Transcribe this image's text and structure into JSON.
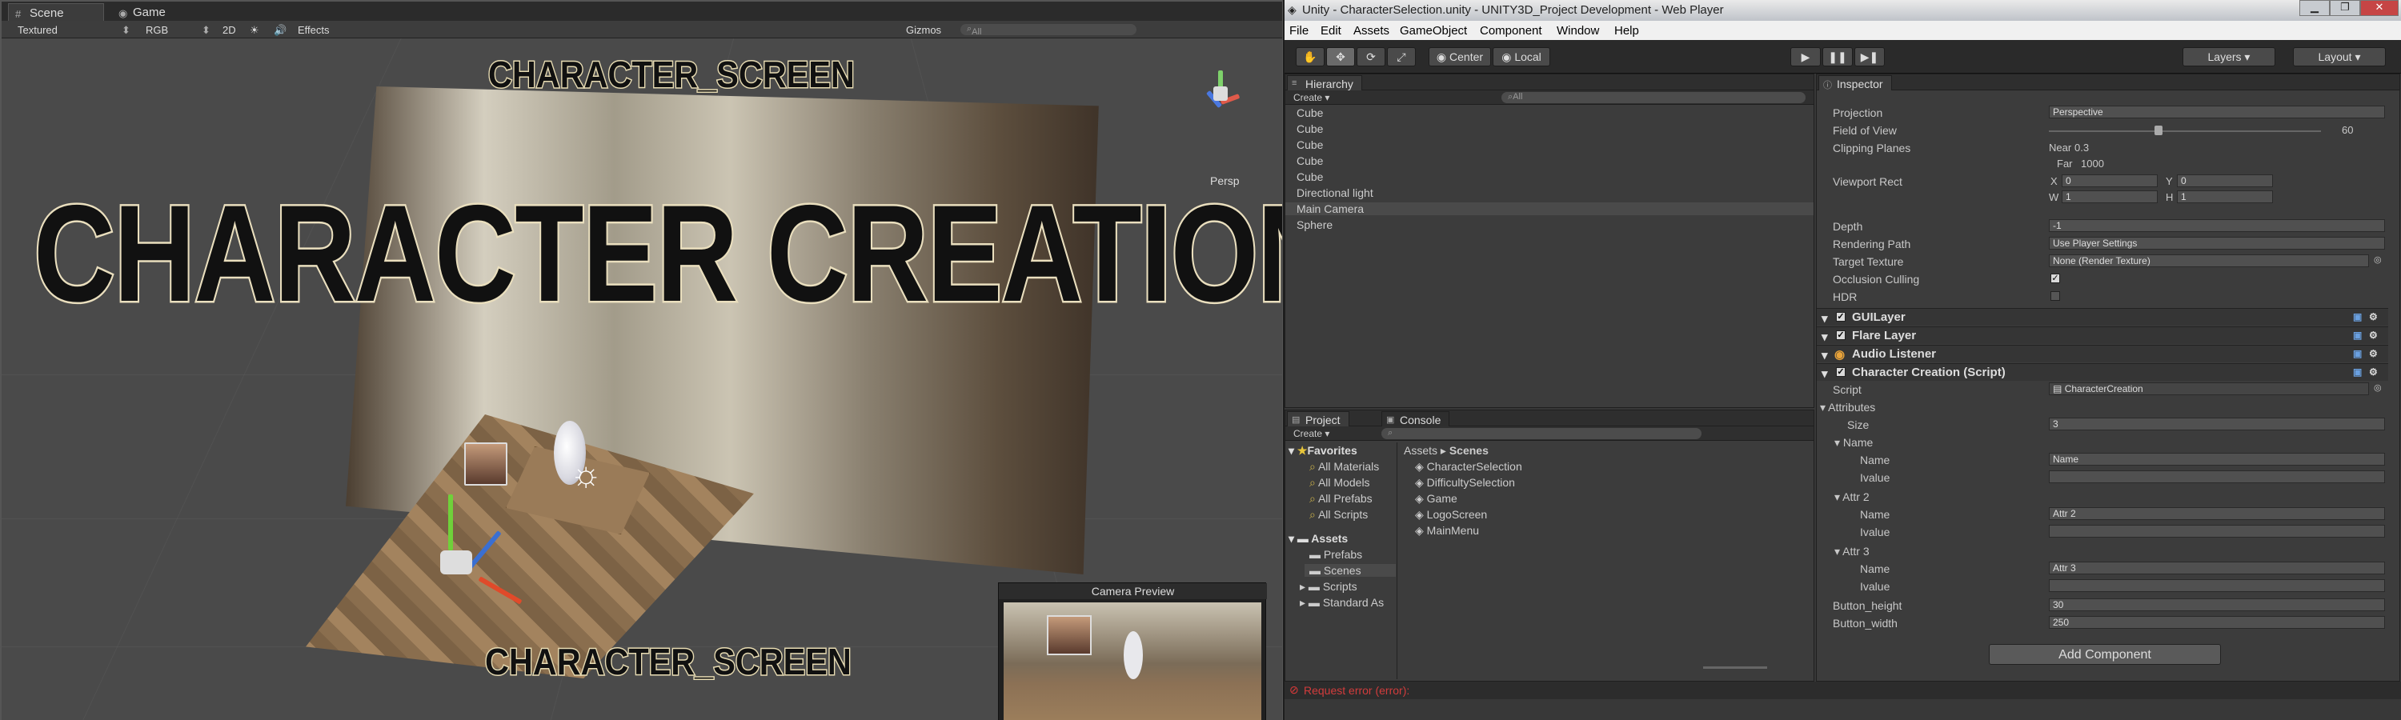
{
  "scene_window": {
    "tabs": [
      {
        "label": "Scene"
      },
      {
        "label": "Game"
      }
    ],
    "toolbar": {
      "shading": "Textured",
      "render": "RGB",
      "mode_2d": "2D",
      "effects": "Effects",
      "gizmos": "Gizmos",
      "search_placeholder": "All"
    },
    "persp_label": "Persp",
    "camera_preview_label": "Camera Preview",
    "overlay": {
      "top_text": "CHARACTER_SCREEN",
      "main_title": "CHARACTER CREATION",
      "bottom_text": "CHARACTER_SCREEN"
    }
  },
  "unity": {
    "window_title": "Unity - CharacterSelection.unity - UNITY3D_Project Development - Web Player",
    "menu": [
      "File",
      "Edit",
      "Assets",
      "GameObject",
      "Component",
      "Window",
      "Help"
    ],
    "toolbar": {
      "center_label": "Center",
      "local_label": "Local",
      "layers_label": "Layers",
      "layout_label": "Layout"
    },
    "hierarchy": {
      "tab": "Hierarchy",
      "create": "Create",
      "search_placeholder": "All",
      "items": [
        "Cube",
        "Cube",
        "Cube",
        "Cube",
        "Cube",
        "Directional light",
        "Main Camera",
        "Sphere"
      ]
    },
    "project": {
      "tabs": [
        "Project",
        "Console"
      ],
      "create": "Create",
      "favorites": {
        "label": "Favorites",
        "items": [
          "All Materials",
          "All Models",
          "All Prefabs",
          "All Scripts"
        ]
      },
      "assets": {
        "label": "Assets",
        "items": [
          "Prefabs",
          "Scenes",
          "Scripts",
          "Standard As"
        ]
      },
      "breadcrumb": [
        "Assets",
        "Scenes"
      ],
      "scenes": [
        "CharacterSelection",
        "DifficultySelection",
        "Game",
        "LogoScreen",
        "MainMenu"
      ]
    },
    "inspector": {
      "tab": "Inspector",
      "camera": {
        "projection": {
          "label": "Projection",
          "value": "Perspective"
        },
        "fov": {
          "label": "Field of View",
          "value": "60"
        },
        "clipping": {
          "label": "Clipping Planes",
          "near_label": "Near",
          "near": "0.3",
          "far_label": "Far",
          "far": "1000"
        },
        "viewport": {
          "label": "Viewport Rect",
          "x_label": "X",
          "x": "0",
          "y_label": "Y",
          "y": "0",
          "w_label": "W",
          "w": "1",
          "h_label": "H",
          "h": "1"
        },
        "depth": {
          "label": "Depth",
          "value": "-1"
        },
        "rendering_path": {
          "label": "Rendering Path",
          "value": "Use Player Settings"
        },
        "target_texture": {
          "label": "Target Texture",
          "value": "None (Render Texture)"
        },
        "occlusion": {
          "label": "Occlusion Culling",
          "checked": true
        },
        "hdr": {
          "label": "HDR",
          "checked": false
        }
      },
      "components": [
        "GUILayer",
        "Flare Layer",
        "Audio Listener",
        "Character Creation (Script)"
      ],
      "script": {
        "label": "Script",
        "value": "CharacterCreation"
      },
      "attributes": {
        "label": "Attributes",
        "size_label": "Size",
        "size": "3",
        "elements": [
          {
            "header": "Name",
            "name_label": "Name",
            "name": "Name",
            "ivalue_label": "Ivalue",
            "ivalue": ""
          },
          {
            "header": "Attr 2",
            "name_label": "Name",
            "name": "Attr 2",
            "ivalue_label": "Ivalue",
            "ivalue": ""
          },
          {
            "header": "Attr 3",
            "name_label": "Name",
            "name": "Attr 3",
            "ivalue_label": "Ivalue",
            "ivalue": ""
          }
        ]
      },
      "button_height": {
        "label": "Button_height",
        "value": "30"
      },
      "button_width": {
        "label": "Button_width",
        "value": "250"
      },
      "add_component": "Add Component"
    },
    "status": "Request error (error):"
  }
}
